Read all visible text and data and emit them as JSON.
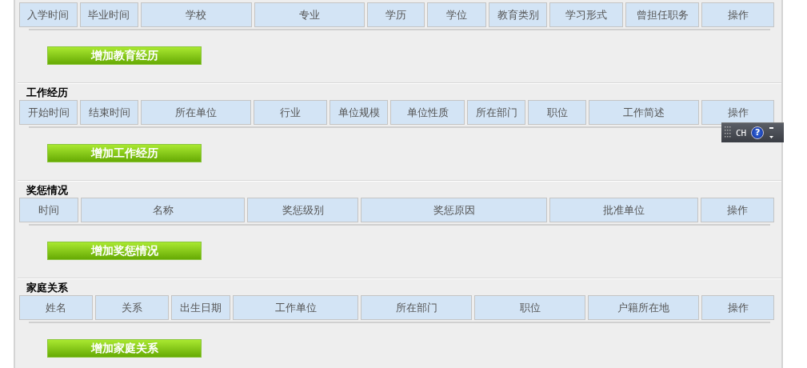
{
  "sections": [
    {
      "columns": [
        "入学时间",
        "毕业时间",
        "学校",
        "专业",
        "学历",
        "学位",
        "教育类别",
        "学习形式",
        "曾担任职务",
        "操作"
      ],
      "button": "增加教育经历"
    },
    {
      "title": "工作经历",
      "columns": [
        "开始时间",
        "结束时间",
        "所在单位",
        "行业",
        "单位规模",
        "单位性质",
        "所在部门",
        "职位",
        "工作简述",
        "操作"
      ],
      "button": "增加工作经历"
    },
    {
      "title": "奖惩情况",
      "columns": [
        "时间",
        "名称",
        "奖惩级别",
        "奖惩原因",
        "批准单位",
        "操作"
      ],
      "button": "增加奖惩情况"
    },
    {
      "title": "家庭关系",
      "columns": [
        "姓名",
        "关系",
        "出生日期",
        "工作单位",
        "所在部门",
        "职位",
        "户籍所在地",
        "操作"
      ],
      "button": "增加家庭关系"
    }
  ],
  "ime_bar": {
    "language": "CH",
    "help": "?"
  }
}
